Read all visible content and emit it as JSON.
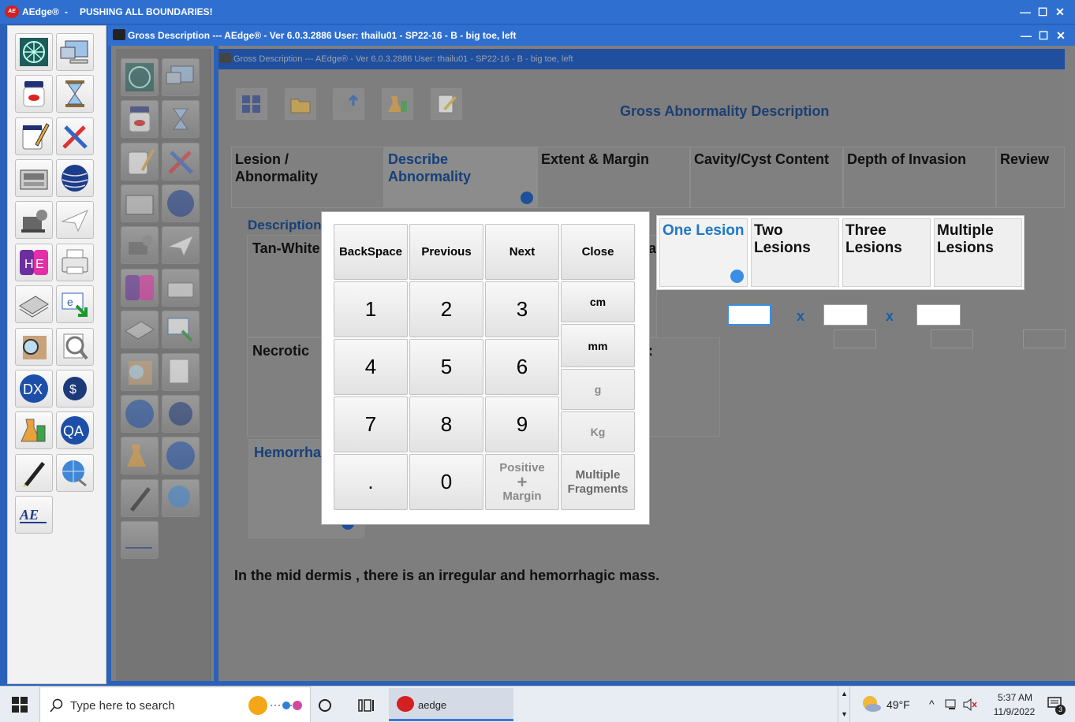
{
  "outer_window": {
    "app_name": "AEdge®",
    "separator": "-",
    "slogan": "PUSHING ALL BOUNDARIES!",
    "logo_text": "AEdge",
    "controls": {
      "minimize": "—",
      "maximize": "☐",
      "close": "✕"
    }
  },
  "gross_window": {
    "title": "Gross Description --- AEdge®  -  Ver 6.0.3.2886  User: thailu01 - SP22-16 - B - big toe, left",
    "controls": {
      "minimize": "—",
      "maximize": "☐",
      "close": "✕"
    }
  },
  "inner_window": {
    "title": "Gross Description --- AEdge®  -  Ver 6.0.3.2886  User: thailu01 - SP22-16 - B - big toe, left"
  },
  "form": {
    "page_title": "Gross Abnormality Description",
    "tabs": [
      {
        "line1": "Lesion /",
        "line2": "Abnormality"
      },
      {
        "line1": "Describe",
        "line2": "Abnormality"
      },
      {
        "line1": "Extent & Margin",
        "line2": ""
      },
      {
        "line1": "Cavity/Cyst Content",
        "line2": ""
      },
      {
        "line1": "Depth of Invasion",
        "line2": ""
      },
      {
        "line1": "Review",
        "line2": ""
      }
    ],
    "description_label": "Description",
    "options": {
      "tan_white": "Tan-White",
      "necrotic": "Necrotic",
      "hemorrhagic": "Hemorrha",
      "hidden_a": "a",
      "hidden_colon": ":"
    },
    "narrative": "In the mid dermis , there is an irregular and hemorrhagic mass."
  },
  "keypad": {
    "backspace": "BackSpace",
    "previous": "Previous",
    "next": "Next",
    "close": "Close",
    "digits": [
      "1",
      "2",
      "3",
      "4",
      "5",
      "6",
      "7",
      "8",
      "9",
      ".",
      "0"
    ],
    "cm": "cm",
    "mm": "mm",
    "g": "g",
    "kg": "Kg",
    "positive_margin": {
      "line1": "Positive",
      "plus": "+",
      "line2": "Margin"
    },
    "multiple_fragments": {
      "line1": "Multiple",
      "line2": "Fragments"
    }
  },
  "lesions": {
    "buttons": [
      {
        "line1": "One Lesion",
        "line2": ""
      },
      {
        "line1": "Two",
        "line2": "Lesions"
      },
      {
        "line1": "Three",
        "line2": "Lesions"
      },
      {
        "line1": "Multiple",
        "line2": "Lesions"
      }
    ],
    "selected": "One Lesion",
    "dimension_separator": "x",
    "dimensions": [
      "",
      "",
      ""
    ]
  },
  "taskbar": {
    "search_placeholder": "Type here to search",
    "running_app": "aedge",
    "weather": "49°F",
    "time": "5:37 AM",
    "date": "11/9/2022",
    "notification_count": "3"
  },
  "colors": {
    "accent_blue": "#2f6fd0",
    "selected_text": "#1e78c8",
    "selection_dot": "#3a8ee6"
  }
}
